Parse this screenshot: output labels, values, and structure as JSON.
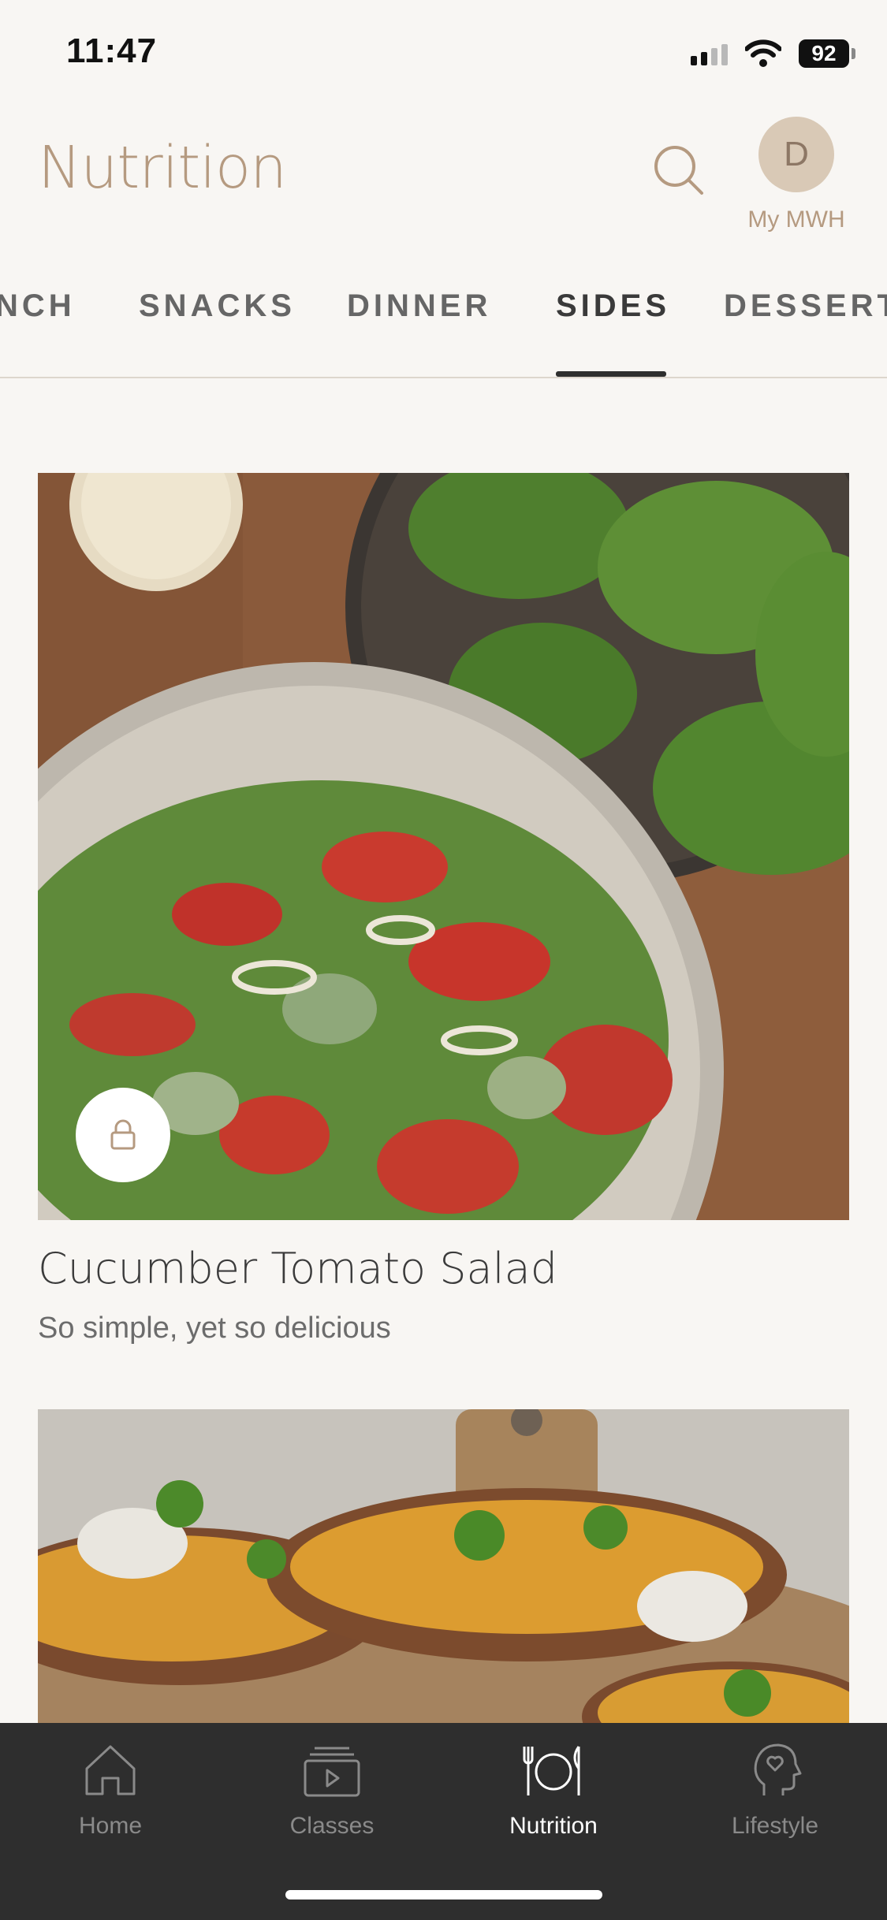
{
  "status_bar": {
    "time": "11:47",
    "battery": "92"
  },
  "header": {
    "title": "Nutrition",
    "avatar_initial": "D",
    "avatar_label": "My MWH"
  },
  "tabs": [
    {
      "label": "NCH"
    },
    {
      "label": "SNACKS"
    },
    {
      "label": "DINNER"
    },
    {
      "label": "SIDES",
      "active": true
    },
    {
      "label": "DESSERT"
    }
  ],
  "recipes": [
    {
      "title": "Cucumber Tomato Salad",
      "subtitle": "So simple, yet so delicious",
      "locked": true
    },
    {
      "title": "",
      "subtitle": ""
    }
  ],
  "bottom_nav": [
    {
      "label": "Home",
      "icon": "home-icon"
    },
    {
      "label": "Classes",
      "icon": "classes-icon"
    },
    {
      "label": "Nutrition",
      "icon": "nutrition-icon",
      "active": true
    },
    {
      "label": "Lifestyle",
      "icon": "lifestyle-icon"
    }
  ],
  "colors": {
    "accent": "#b59a80",
    "background": "#f8f6f3",
    "nav_background": "#2e2e2e"
  }
}
